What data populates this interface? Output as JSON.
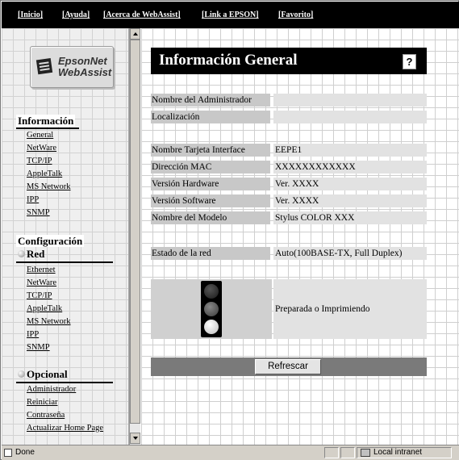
{
  "topnav": {
    "inicio": "[Inicio]",
    "ayuda": "[Ayuda]",
    "acerca": "[Acerca de WebAssist]",
    "link_epson": "[Link a EPSON]",
    "favorito": "[Favorito]"
  },
  "logo": {
    "line1": "EpsonNet",
    "line2": "WebAssist"
  },
  "sidebar": {
    "informacion_title": "Información",
    "informacion_items": [
      "General",
      "NetWare",
      "TCP/IP",
      "AppleTalk",
      "MS Network",
      "IPP",
      "SNMP"
    ],
    "configuracion_title": "Configuración",
    "red_title": "Red",
    "red_items": [
      "Ethernet",
      "NetWare",
      "TCP/IP",
      "AppleTalk",
      "MS Network",
      "IPP",
      "SNMP"
    ],
    "opcional_title": "Opcional",
    "opcional_items": [
      "Administrador",
      "Reiniciar",
      "Contraseña",
      "Actualizar Home Page"
    ]
  },
  "main": {
    "title": "Información General",
    "help_icon": "?",
    "rows": [
      {
        "label": "Nombre del Administrador",
        "value": ""
      },
      {
        "label": "Localización",
        "value": ""
      },
      {
        "label": "Nombre Tarjeta Interface",
        "value": "EEPE1"
      },
      {
        "label": "Dirección MAC",
        "value": "XXXXXXXXXXXX"
      },
      {
        "label": "Versión Hardware",
        "value": "Ver. XXXX"
      },
      {
        "label": "Versión Software",
        "value": "Ver. XXXX"
      },
      {
        "label": "Nombre del Modelo",
        "value": "Stylus COLOR XXX"
      },
      {
        "label": "Estado de la red",
        "value": "Auto(100BASE-TX, Full Duplex)"
      }
    ],
    "printer_status": "Preparada o Imprimiendo",
    "refresh_label": "Refrescar"
  },
  "statusbar": {
    "text": "Done",
    "zone": "Local intranet"
  }
}
